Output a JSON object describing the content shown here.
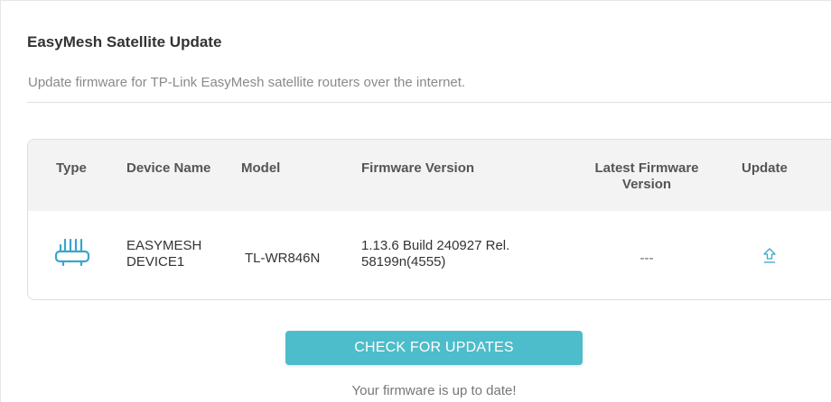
{
  "section": {
    "title": "EasyMesh Satellite Update",
    "description": "Update firmware for TP-Link EasyMesh satellite routers over the internet."
  },
  "table": {
    "headers": {
      "type": "Type",
      "device_name": "Device Name",
      "model": "Model",
      "firmware_version": "Firmware Version",
      "latest_firmware_line1": "Latest Firmware",
      "latest_firmware_line2": "Version",
      "update": "Update"
    },
    "rows": [
      {
        "type_icon": "router-icon",
        "device_name_line1": "EASYMESH",
        "device_name_line2": "DEVICE1",
        "model": "TL-WR846N",
        "firmware_line1": "1.13.6 Build 240927 Rel.",
        "firmware_line2": "58199n(4555)",
        "latest_firmware": "---",
        "update_icon": "upload-arrow-icon"
      }
    ]
  },
  "actions": {
    "check_button_label": "CHECK FOR UPDATES",
    "status_message": "Your firmware is up to date!"
  },
  "colors": {
    "accent": "#4dbccb",
    "header_bg": "#f3f3f3",
    "icon": "#3aa6c8"
  }
}
